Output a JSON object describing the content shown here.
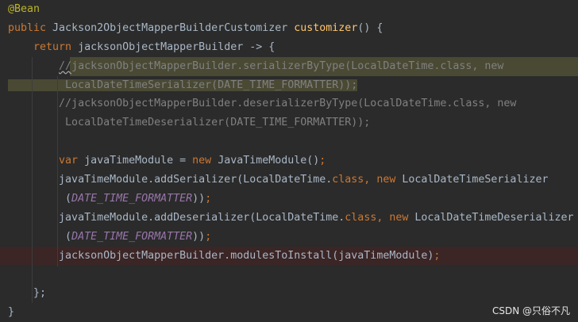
{
  "editor": {
    "lines": [
      [
        {
          "t": "@Bean",
          "c": "a"
        }
      ],
      [
        {
          "t": "public ",
          "c": "k"
        },
        {
          "t": "Jackson2ObjectMapperBuilderCustomizer ",
          "c": "t"
        },
        {
          "t": "customizer",
          "c": "m"
        },
        {
          "t": "() {",
          "c": "t"
        }
      ],
      [
        {
          "t": "    "
        },
        {
          "t": "return ",
          "c": "k"
        },
        {
          "t": "jacksonObjectMapperBuilder -> {",
          "c": "t"
        }
      ],
      [
        {
          "t": "        "
        },
        {
          "t": "//",
          "c": "c wavy"
        },
        {
          "t": "jacksonObjectMapperBuilder.serializerByType(LocalDateTime.class, new",
          "c": "c",
          "hl": true
        }
      ],
      [
        {
          "t": "         LocalDateTimeSerializer(DATE_TIME_FORMATTER));",
          "c": "c",
          "hl": true
        }
      ],
      [
        {
          "t": "        "
        },
        {
          "t": "//jacksonObjectMapperBuilder.deserializerByType(LocalDateTime.class, new",
          "c": "c"
        }
      ],
      [
        {
          "t": "         LocalDateTimeDeserializer(DATE_TIME_FORMATTER));",
          "c": "c"
        }
      ],
      [],
      [
        {
          "t": "        "
        },
        {
          "t": "var ",
          "c": "k"
        },
        {
          "t": "javaTimeModule = ",
          "c": "t"
        },
        {
          "t": "new ",
          "c": "k"
        },
        {
          "t": "JavaTimeModule()",
          "c": "t"
        },
        {
          "t": ";",
          "c": "k"
        }
      ],
      [
        {
          "t": "        "
        },
        {
          "t": "javaTimeModule.addSerializer(LocalDateTime.",
          "c": "t"
        },
        {
          "t": "class, new ",
          "c": "k"
        },
        {
          "t": "LocalDateTimeSerializer",
          "c": "t"
        }
      ],
      [
        {
          "t": "         ("
        },
        {
          "t": "DATE_TIME_FORMATTER",
          "c": "p"
        },
        {
          "t": "))",
          "c": "t"
        },
        {
          "t": ";",
          "c": "k"
        }
      ],
      [
        {
          "t": "        "
        },
        {
          "t": "javaTimeModule.addDeserializer(LocalDateTime.",
          "c": "t"
        },
        {
          "t": "class, new ",
          "c": "k"
        },
        {
          "t": "LocalDateTimeDeserializer",
          "c": "t"
        }
      ],
      [
        {
          "t": "         ("
        },
        {
          "t": "DATE_TIME_FORMATTER",
          "c": "p"
        },
        {
          "t": "))",
          "c": "t"
        },
        {
          "t": ";",
          "c": "k"
        }
      ],
      [
        {
          "t": "        "
        },
        {
          "t": "jacksonObjectMapperBuilder.modulesToInstall(javaTimeModule)",
          "c": "t"
        },
        {
          "t": ";",
          "c": "k"
        }
      ],
      [],
      [
        {
          "t": "    };",
          "c": "t"
        }
      ],
      [
        {
          "t": "}",
          "c": "t"
        }
      ]
    ],
    "error_line_index": 13
  },
  "watermark": "CSDN @只俗不凡"
}
